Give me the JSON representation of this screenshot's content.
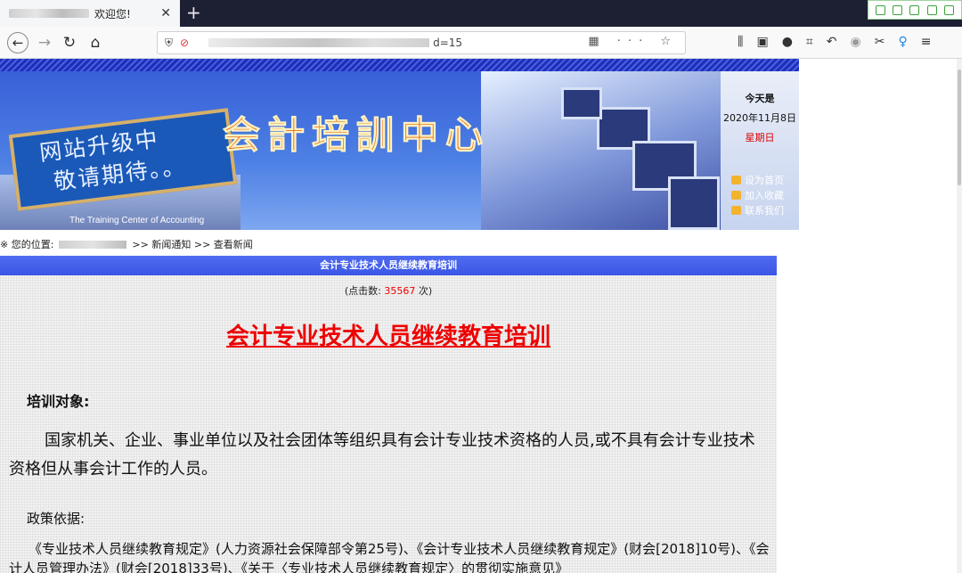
{
  "browser": {
    "tab_title": "欢迎您!",
    "tab_close": "✕",
    "new_tab": "+",
    "url_suffix": "d=15",
    "url_actions": "▦ ··· ☆",
    "toolbar_icons": [
      "library-icon",
      "sidebar-icon",
      "account-icon",
      "crop-icon",
      "undo-icon",
      "block-icon",
      "scissors-icon",
      "pin-icon",
      "menu-icon"
    ]
  },
  "banner": {
    "sign_line1": "网站升级中",
    "sign_line2": "敬请期待。。",
    "title": "会計培訓中心",
    "title_en": "The Training Center of Accounting",
    "today_label": "今天是",
    "date": "2020年11月8日",
    "weekday": "星期日",
    "links": [
      "设为首页",
      "加入收藏",
      "联系我们"
    ]
  },
  "breadcrumb": {
    "prefix": "※ 您的位置:",
    "rest": ">> 新闻通知 >> 查看新闻"
  },
  "article": {
    "header_bar": "会计专业技术人员继续教育培训",
    "clicks_prefix": "(点击数:",
    "clicks_value": "35567",
    "clicks_suffix": "次)",
    "title": "会计专业技术人员继续教育培训",
    "section_head": "培训对象:",
    "paragraph": "国家机关、企业、事业单位以及社会团体等组织具有会计专业技术资格的人员,或不具有会计专业技术资格但从事会计工作的人员。",
    "policy_head": "政策依据:",
    "policy_text": "《专业技术人员继续教育规定》(人力资源社会保障部令第25号)、《会计专业技术人员继续教育规定》(财会[2018]10号)、《会计人员管理办法》(财会[2018]33号)、《关于〈专业技术人员继续教育规定〉的贯彻实施意见》"
  }
}
